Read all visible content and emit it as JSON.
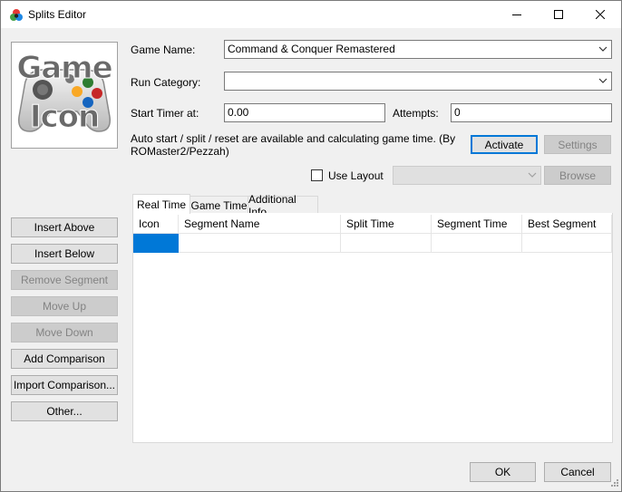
{
  "window": {
    "title": "Splits Editor"
  },
  "game_icon": {
    "line1": "Game",
    "line2": "Icon"
  },
  "fields": {
    "game_name_label": "Game Name:",
    "game_name_value": "Command & Conquer Remastered",
    "run_category_label": "Run Category:",
    "run_category_value": "",
    "start_timer_label": "Start Timer at:",
    "start_timer_value": "0.00",
    "attempts_label": "Attempts:",
    "attempts_value": "0"
  },
  "autosplitter": {
    "description": "Auto start / split / reset are available and calculating game time. (By ROMaster2/Pezzah)",
    "activate_label": "Activate",
    "settings_label": "Settings"
  },
  "layout": {
    "use_layout_label": "Use Layout",
    "use_layout_checked": false,
    "layout_value": "",
    "browse_label": "Browse"
  },
  "tabs": [
    {
      "label": "Real Time",
      "active": true
    },
    {
      "label": "Game Time",
      "active": false
    },
    {
      "label": "Additional Info",
      "active": false
    }
  ],
  "table": {
    "columns": [
      "Icon",
      "Segment Name",
      "Split Time",
      "Segment Time",
      "Best Segment"
    ],
    "rows": [
      {
        "icon": "",
        "segment_name": "",
        "split_time": "",
        "segment_time": "",
        "best_segment": ""
      }
    ]
  },
  "side_buttons": {
    "insert_above": "Insert Above",
    "insert_below": "Insert Below",
    "remove_segment": "Remove Segment",
    "move_up": "Move Up",
    "move_down": "Move Down",
    "add_comparison": "Add Comparison",
    "import_comparison": "Import Comparison...",
    "other": "Other..."
  },
  "footer": {
    "ok_label": "OK",
    "cancel_label": "Cancel"
  },
  "colors": {
    "selection": "#0078d7",
    "button_border": "#adadad",
    "disabled_text": "#838383"
  }
}
